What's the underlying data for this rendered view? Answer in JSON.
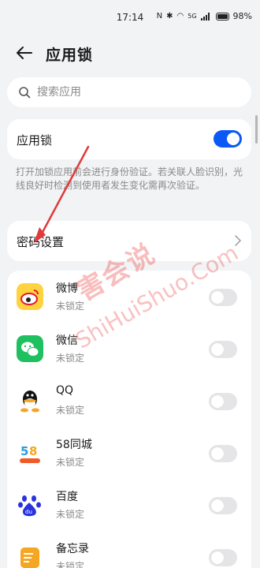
{
  "status": {
    "time": "17:14",
    "battery": "98%",
    "network": "5G"
  },
  "header": {
    "title": "应用锁"
  },
  "search": {
    "placeholder": "搜索应用"
  },
  "lock_switch": {
    "label": "应用锁",
    "on": true
  },
  "description": "打开加锁应用前会进行身份验证。若关联人脸识别，光线良好时检测到使用者发生变化需再次验证。",
  "password": {
    "label": "密码设置"
  },
  "apps": [
    {
      "name": "微博",
      "status": "未锁定",
      "icon": "weibo-icon"
    },
    {
      "name": "微信",
      "status": "未锁定",
      "icon": "wechat-icon"
    },
    {
      "name": "QQ",
      "status": "未锁定",
      "icon": "qq-icon"
    },
    {
      "name": "58同城",
      "status": "未锁定",
      "icon": "58-icon"
    },
    {
      "name": "百度",
      "status": "未锁定",
      "icon": "baidu-icon"
    },
    {
      "name": "备忘录",
      "status": "未锁定",
      "icon": "memo-icon"
    }
  ],
  "watermark": {
    "cn": "害会说",
    "en": "ShiHuiShuo.Com"
  },
  "colors": {
    "accent": "#0a59f7",
    "background": "#f1f3f5",
    "annotation": "#e03a3a"
  }
}
